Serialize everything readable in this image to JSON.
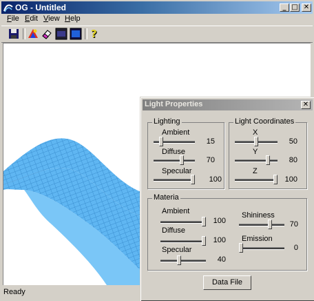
{
  "window": {
    "title": "OG - Untitled",
    "caption_buttons": {
      "minimize": "_",
      "maximize": "□",
      "close": "✕"
    }
  },
  "menubar": {
    "items": [
      {
        "label": "File",
        "accel": "F"
      },
      {
        "label": "Edit",
        "accel": "E"
      },
      {
        "label": "View",
        "accel": "V"
      },
      {
        "label": "Help",
        "accel": "H"
      }
    ]
  },
  "toolbar": {
    "buttons": [
      "save-icon",
      "colors-icon",
      "eraser-icon",
      "dark-view-icon",
      "blue-view-icon",
      "help-icon"
    ]
  },
  "statusbar": {
    "text": "Ready"
  },
  "dialog": {
    "title": "Light Properties",
    "close_glyph": "✕",
    "lighting": {
      "legend": "Lighting",
      "ambient": {
        "label": "Ambient",
        "value": "15",
        "level": 0.15
      },
      "diffuse": {
        "label": "Diffuse",
        "value": "70",
        "level": 0.7
      },
      "specular": {
        "label": "Specular",
        "value": "100",
        "level": 1.0
      }
    },
    "coords": {
      "legend": "Light Coordinates",
      "x": {
        "label": "X",
        "value": "50",
        "level": 0.5
      },
      "y": {
        "label": "Y",
        "value": "80",
        "level": 0.8
      },
      "z": {
        "label": "Z",
        "value": "100",
        "level": 1.0
      }
    },
    "material": {
      "legend": "Materia",
      "ambient": {
        "label": "Ambient",
        "value": "100",
        "level": 1.0
      },
      "diffuse": {
        "label": "Diffuse",
        "value": "100",
        "level": 1.0
      },
      "specular": {
        "label": "Specular",
        "value": "40",
        "level": 0.4
      },
      "shininess": {
        "label": "Shininess",
        "value": "70",
        "level": 0.7
      },
      "emission": {
        "label": "Emission",
        "value": "0",
        "level": 0.0
      }
    },
    "data_file_button": "Data File"
  },
  "colors": {
    "surface": "#5fb6f2",
    "surface_dark": "#3b8fd0",
    "title_active": "#0a246a",
    "title_inactive": "#808080"
  }
}
